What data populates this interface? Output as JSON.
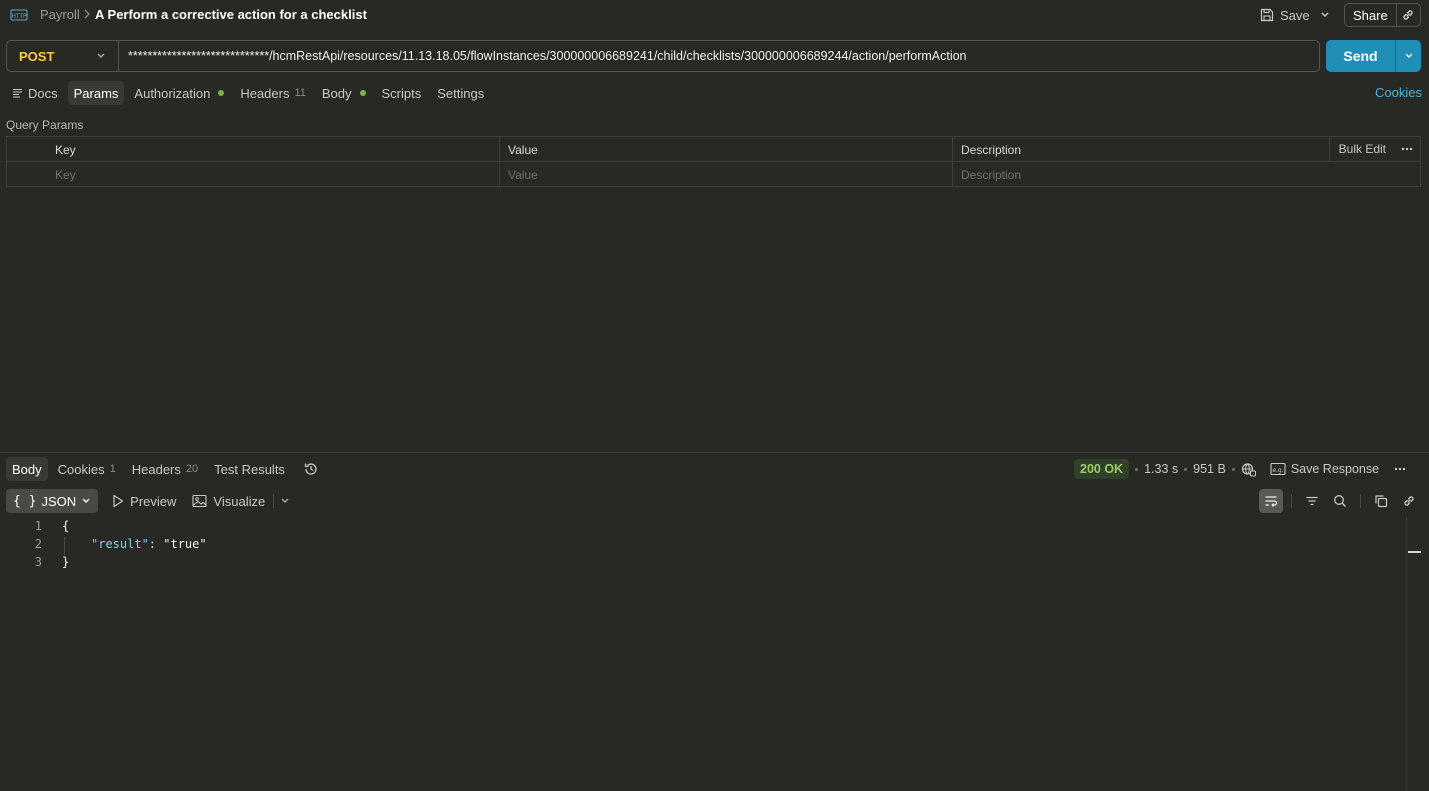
{
  "breadcrumb": {
    "parent": "Payroll",
    "title": "A Perform a corrective action for a checklist"
  },
  "header": {
    "save_label": "Save",
    "share_label": "Share"
  },
  "request": {
    "method": "POST",
    "url": "*****************************/hcmRestApi/resources/11.13.18.05/flowInstances/300000006689241/child/checklists/300000006689244/action/performAction",
    "send_label": "Send"
  },
  "request_tabs": [
    {
      "label": "Docs"
    },
    {
      "label": "Params"
    },
    {
      "label": "Authorization"
    },
    {
      "label": "Headers",
      "count": "11"
    },
    {
      "label": "Body"
    },
    {
      "label": "Scripts"
    },
    {
      "label": "Settings"
    }
  ],
  "cookies_link": "Cookies",
  "query_params": {
    "title": "Query Params",
    "columns": [
      "Key",
      "Value",
      "Description"
    ],
    "placeholders": [
      "Key",
      "Value",
      "Description"
    ],
    "bulk_edit": "Bulk Edit"
  },
  "response_tabs": [
    {
      "label": "Body"
    },
    {
      "label": "Cookies",
      "count": "1"
    },
    {
      "label": "Headers",
      "count": "20"
    },
    {
      "label": "Test Results"
    }
  ],
  "response_meta": {
    "status": "200 OK",
    "time": "1.33 s",
    "size": "951 B",
    "save_response": "Save Response"
  },
  "format_bar": {
    "format": "JSON",
    "preview": "Preview",
    "visualize": "Visualize"
  },
  "code": {
    "line_numbers": [
      "1",
      "2",
      "3"
    ],
    "open_brace": "{",
    "key": "\"result\"",
    "colon": ": ",
    "value": "\"true\"",
    "close_brace": "}"
  },
  "colors": {
    "background": "#282824",
    "method": "#ffc940",
    "send": "#1f8fb8",
    "status_ok": "#9ccc65",
    "json_key": "#7fd3f5",
    "indicator_dot": "#7cb342",
    "link": "#4fb0df"
  }
}
